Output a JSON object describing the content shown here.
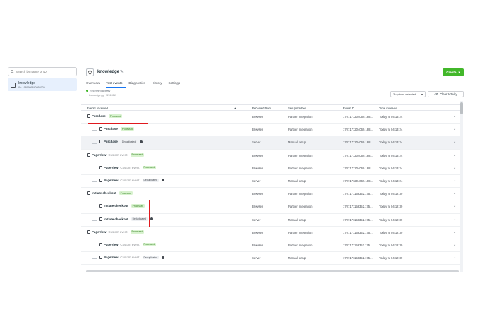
{
  "sidebar": {
    "search_placeholder": "Search by name or ID",
    "dataset": {
      "name": "knowledge",
      "id": "ID: 1989999840959729"
    }
  },
  "header": {
    "title": "knowledge",
    "create_label": "Create"
  },
  "tabs": [
    "Overview",
    "Test events",
    "Diagnostics",
    "History",
    "Settings"
  ],
  "activity": {
    "status": "Receiving activity",
    "subtext": "knowledge.gg  ·  72913313",
    "options_label": "3 options selected",
    "clear_label": "Clear Activity"
  },
  "table": {
    "columns": [
      "Events received",
      "Received from",
      "Setup method",
      "Event ID",
      "Time received"
    ],
    "rows": [
      {
        "event": "Purchase",
        "sub": "",
        "badge": "Processed",
        "from": "Browser",
        "setup": "Partner integration",
        "id": "1707171204069.188...",
        "time": "Today at 04:13:24",
        "child": false
      },
      {
        "event": "Purchase",
        "sub": "",
        "badge": "Processed",
        "from": "Browser",
        "setup": "Partner integration",
        "id": "1707171204069.188...",
        "time": "Today at 04:13:24",
        "child": true
      },
      {
        "event": "Purchase",
        "sub": "",
        "badge": "Deduplicated",
        "from": "Server",
        "setup": "Manual setup",
        "id": "1707171204069.188...",
        "time": "Today at 04:13:24",
        "child": true
      },
      {
        "event": "PageView",
        "sub": "Custom event",
        "badge": "Processed",
        "from": "Browser",
        "setup": "Partner integration",
        "id": "1707171204069.188...",
        "time": "Today at 04:13:24",
        "child": false
      },
      {
        "event": "PageView",
        "sub": "Custom event",
        "badge": "Processed",
        "from": "Browser",
        "setup": "Partner integration",
        "id": "1707171204069.188...",
        "time": "Today at 04:13:24",
        "child": true
      },
      {
        "event": "PageView",
        "sub": "Custom event",
        "badge": "Deduplicated",
        "from": "Server",
        "setup": "Manual setup",
        "id": "1707171204069.188...",
        "time": "Today at 04:13:24",
        "child": true
      },
      {
        "event": "Initiate checkout",
        "sub": "",
        "badge": "Processed",
        "from": "Browser",
        "setup": "Partner integration",
        "id": "1707171158352.175...",
        "time": "Today at 04:12:39",
        "child": false
      },
      {
        "event": "Initiate checkout",
        "sub": "",
        "badge": "Processed",
        "from": "Browser",
        "setup": "Partner integration",
        "id": "1707171158352.175...",
        "time": "Today at 04:12:39",
        "child": true
      },
      {
        "event": "Initiate checkout",
        "sub": "",
        "badge": "Deduplicated",
        "from": "Server",
        "setup": "Manual setup",
        "id": "1707171158352.175...",
        "time": "Today at 04:12:39",
        "child": true
      },
      {
        "event": "PageView",
        "sub": "Custom event",
        "badge": "Processed",
        "from": "Browser",
        "setup": "Partner integration",
        "id": "1707171158352.175...",
        "time": "Today at 04:12:39",
        "child": false
      },
      {
        "event": "PageView",
        "sub": "Custom event",
        "badge": "Processed",
        "from": "Browser",
        "setup": "Partner integration",
        "id": "1707171158352.175...",
        "time": "Today at 04:12:39",
        "child": true
      },
      {
        "event": "PageView",
        "sub": "Custom event",
        "badge": "Deduplicated",
        "from": "Server",
        "setup": "Manual setup",
        "id": "1707171158352.175...",
        "time": "Today at 04:12:39",
        "child": true
      }
    ]
  },
  "colors": {
    "accent": "#1877f2",
    "create": "#42b72a",
    "highlight_box": "#e0191e",
    "processed_bg": "#d8f2cf"
  }
}
